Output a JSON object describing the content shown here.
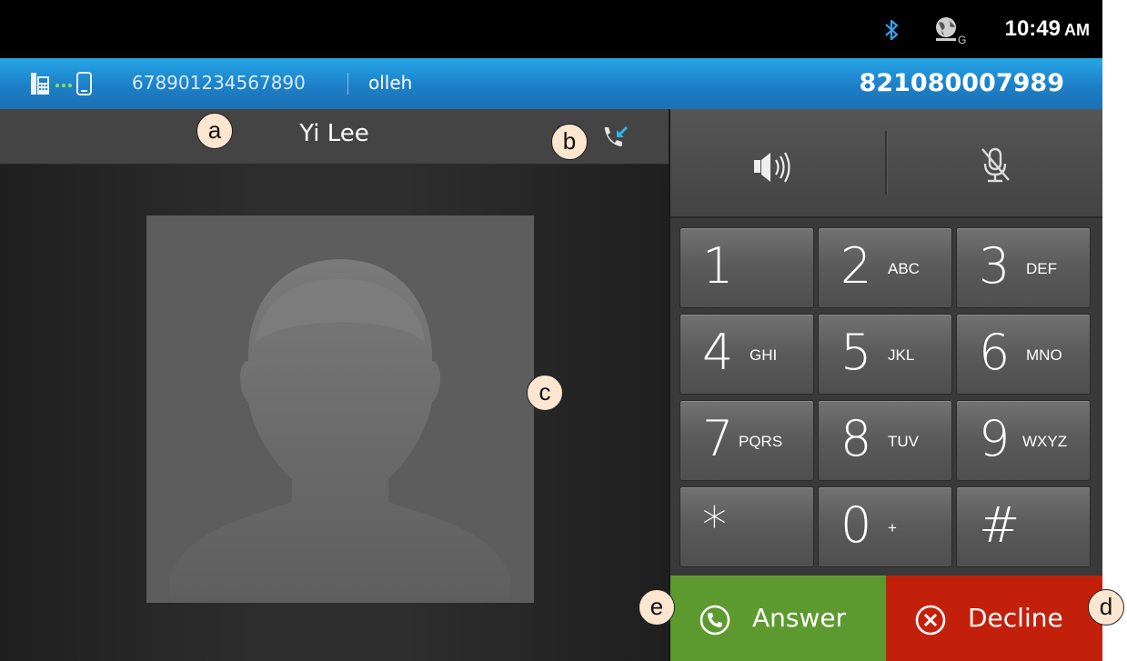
{
  "status_bar": {
    "time": "10:49",
    "ampm": "AM",
    "icons": [
      "bluetooth-icon",
      "globe-gps-icon"
    ]
  },
  "info_bar": {
    "icons": [
      "desk-phone-icon",
      "connection-dots-icon",
      "mobile-phone-icon"
    ],
    "line_number": "678901234567890",
    "carrier": "olleh",
    "own_number": "821080007989"
  },
  "caller": {
    "name": "Yi Lee",
    "status_icon": "incoming-call-icon",
    "avatar": "default-contact-silhouette"
  },
  "audio_controls": {
    "speaker_icon": "speaker-icon",
    "mute_icon": "mic-muted-icon"
  },
  "keypad": [
    {
      "digit": "1",
      "letters": ""
    },
    {
      "digit": "2",
      "letters": "ABC"
    },
    {
      "digit": "3",
      "letters": "DEF"
    },
    {
      "digit": "4",
      "letters": "GHI"
    },
    {
      "digit": "5",
      "letters": "JKL"
    },
    {
      "digit": "6",
      "letters": "MNO"
    },
    {
      "digit": "7",
      "letters": "PQRS"
    },
    {
      "digit": "8",
      "letters": "TUV"
    },
    {
      "digit": "9",
      "letters": "WXYZ"
    },
    {
      "digit": "*",
      "letters": ""
    },
    {
      "digit": "0",
      "letters": "+"
    },
    {
      "digit": "#",
      "letters": ""
    }
  ],
  "actions": {
    "answer_label": "Answer",
    "decline_label": "Decline",
    "answer_color": "#5c9a30",
    "decline_color": "#c3200c"
  },
  "callouts": {
    "a": "a",
    "b": "b",
    "c": "c",
    "d": "d",
    "e": "e"
  },
  "colors": {
    "info_bar_blue": "#1d7fc8",
    "incoming_icon": "#2fb6e8"
  }
}
